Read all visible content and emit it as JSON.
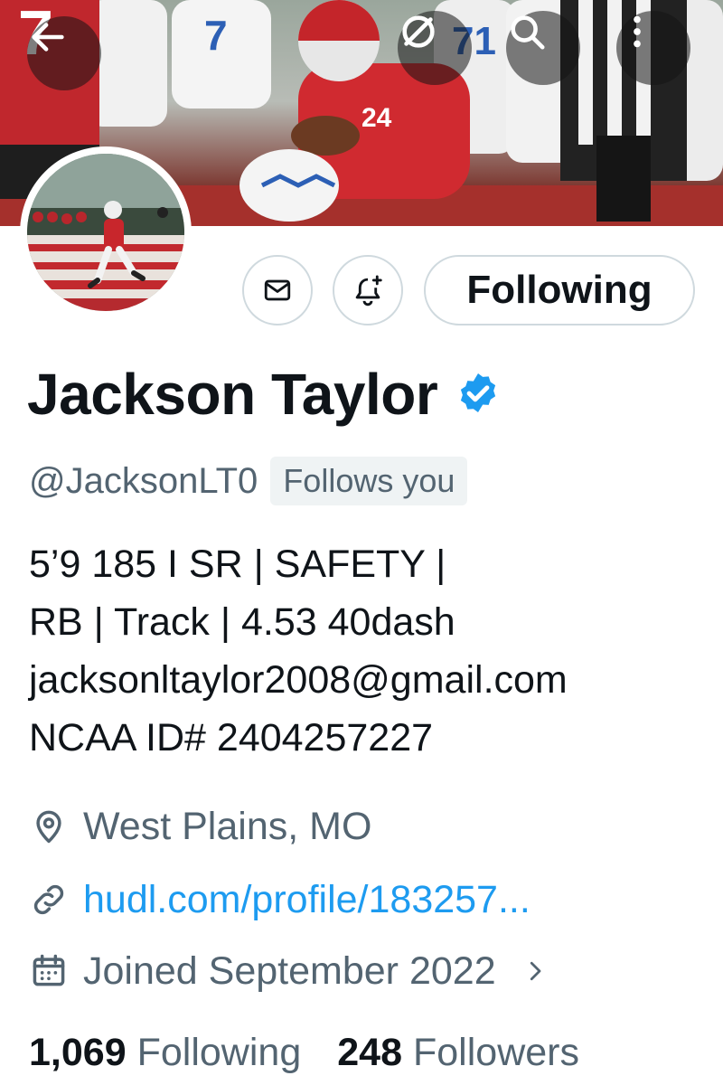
{
  "header": {
    "banner_jersey_number": "24",
    "back_label": "Back",
    "search_label": "Search",
    "more_label": "More options"
  },
  "actions": {
    "following_label": "Following"
  },
  "profile": {
    "display_name": "Jackson Taylor",
    "handle": "@JacksonLT0",
    "follows_you_badge": "Follows you",
    "bio_lines": [
      "5’9 185 I SR | SAFETY |",
      "RB | Track | 4.53 40dash",
      "jacksonltaylor2008@gmail.com",
      "NCAA ID# 2404257227"
    ],
    "location": "West Plains, MO",
    "website": "hudl.com/profile/183257...",
    "joined": "Joined September 2022",
    "following_count": "1,069",
    "following_label": "Following",
    "followers_count": "248",
    "followers_label": "Followers"
  },
  "icons": {
    "back": "arrow-left-icon",
    "no_wifi": "slashed-circle-icon",
    "search": "search-icon",
    "more": "more-vertical-icon",
    "message": "envelope-icon",
    "notify": "bell-plus-icon",
    "verified": "verified-badge-icon",
    "location": "location-pin-icon",
    "link": "link-icon",
    "calendar": "calendar-icon",
    "chevron": "chevron-right-icon"
  },
  "colors": {
    "accent_blue": "#1d9bf0",
    "text_primary": "#0f1419",
    "text_secondary": "#536471",
    "border": "#cfd9de",
    "badge_bg": "#eff3f4"
  }
}
